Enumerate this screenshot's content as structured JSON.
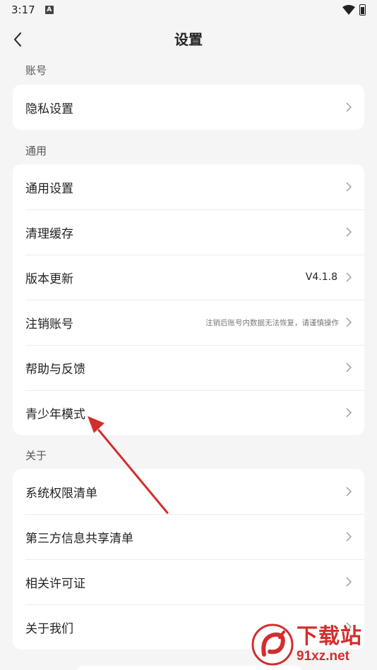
{
  "status_bar": {
    "time": "3:17",
    "notification_letter": "A"
  },
  "header": {
    "title": "设置"
  },
  "sections": [
    {
      "label": "账号",
      "items": [
        {
          "label": "隐私设置"
        }
      ]
    },
    {
      "label": "通用",
      "items": [
        {
          "label": "通用设置"
        },
        {
          "label": "清理缓存"
        },
        {
          "label": "版本更新",
          "value": "V4.1.8"
        },
        {
          "label": "注销账号",
          "hint": "注销后账号内数据无法恢复，请谨慎操作"
        },
        {
          "label": "帮助与反馈"
        },
        {
          "label": "青少年模式"
        }
      ]
    },
    {
      "label": "关于",
      "items": [
        {
          "label": "系统权限清单"
        },
        {
          "label": "第三方信息共享清单"
        },
        {
          "label": "相关许可证"
        },
        {
          "label": "关于我们"
        }
      ]
    }
  ],
  "watermark": {
    "name": "下载站",
    "url": "91xz.net"
  },
  "colors": {
    "accent_red": "#d42d2d",
    "background": "#f5f5f5",
    "card": "#ffffff"
  },
  "icons": [
    "back-arrow-icon",
    "wifi-icon",
    "battery-icon",
    "chevron-right-icon"
  ]
}
